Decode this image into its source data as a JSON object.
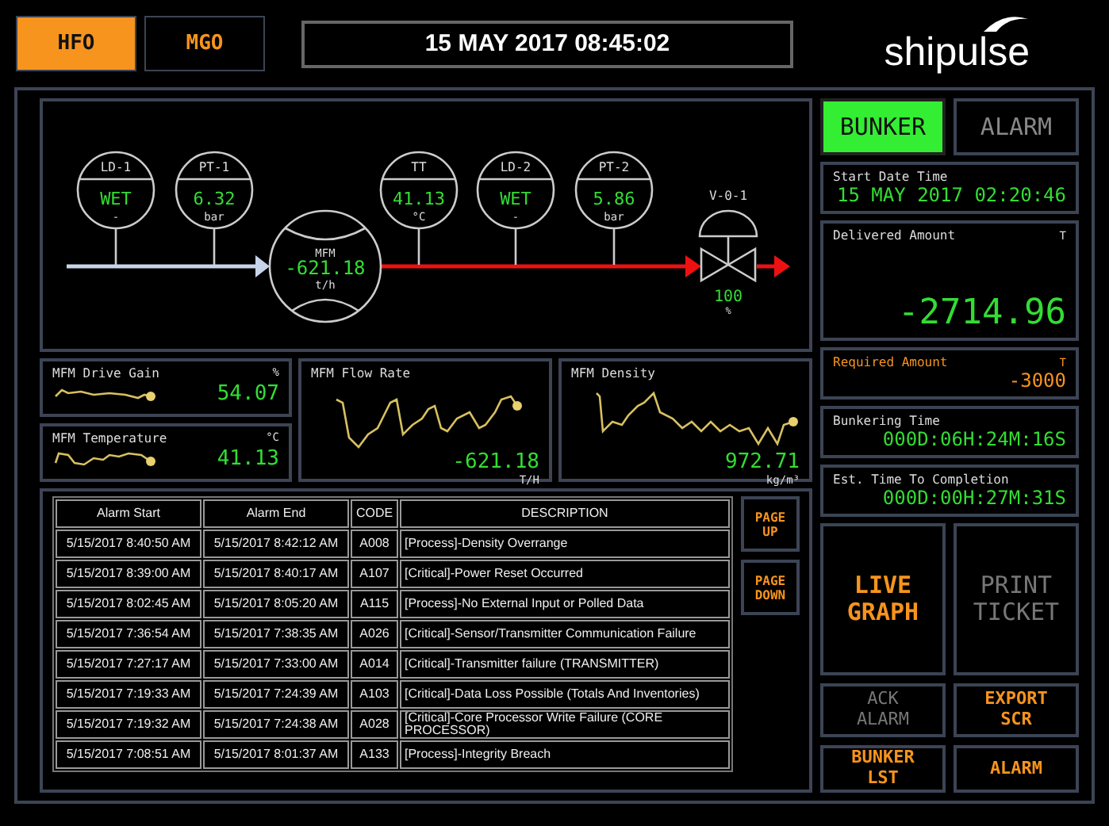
{
  "fuel_tabs": [
    {
      "label": "HFO",
      "selected": true
    },
    {
      "label": "MGO",
      "selected": false
    }
  ],
  "datetime": "15 MAY 2017 08:45:02",
  "logo": "shipulse",
  "diagram": {
    "instruments": [
      {
        "kind": "transmitter",
        "tag": "LD-1",
        "value": "WET",
        "unit": "-"
      },
      {
        "kind": "transmitter",
        "tag": "PT-1",
        "value": "6.32",
        "unit": "bar"
      },
      {
        "kind": "flowmeter",
        "tag": "MFM",
        "value": "-621.18",
        "unit": "t/h"
      },
      {
        "kind": "transmitter",
        "tag": "TT",
        "value": "41.13",
        "unit": "°C"
      },
      {
        "kind": "transmitter",
        "tag": "LD-2",
        "value": "WET",
        "unit": "-"
      },
      {
        "kind": "transmitter",
        "tag": "PT-2",
        "value": "5.86",
        "unit": "bar"
      },
      {
        "kind": "valve",
        "tag": "V-0-1",
        "value": "100",
        "unit": "%"
      }
    ]
  },
  "trends": [
    {
      "kind": "compact",
      "label": "MFM Drive Gain",
      "unit": "%",
      "value": "54.07"
    },
    {
      "kind": "compact",
      "label": "MFM Temperature",
      "unit": "°C",
      "value": "41.13"
    },
    {
      "kind": "wide",
      "label": "MFM Flow Rate",
      "unit": "T/H",
      "value": "-621.18"
    },
    {
      "kind": "wide",
      "label": "MFM Density",
      "unit": "kg/m³",
      "value": "972.71"
    }
  ],
  "alarm_table": {
    "columns": [
      "Alarm Start",
      "Alarm End",
      "CODE",
      "DESCRIPTION"
    ],
    "rows": [
      [
        "5/15/2017 8:40:50 AM",
        "5/15/2017 8:42:12 AM",
        "A008",
        "[Process]-Density Overrange"
      ],
      [
        "5/15/2017 8:39:00 AM",
        "5/15/2017 8:40:17 AM",
        "A107",
        "[Critical]-Power Reset Occurred"
      ],
      [
        "5/15/2017 8:02:45 AM",
        "5/15/2017 8:05:20 AM",
        "A115",
        "[Process]-No External Input or Polled Data"
      ],
      [
        "5/15/2017 7:36:54 AM",
        "5/15/2017 7:38:35 AM",
        "A026",
        "[Critical]-Sensor/Transmitter Communication Failure"
      ],
      [
        "5/15/2017 7:27:17 AM",
        "5/15/2017 7:33:00 AM",
        "A014",
        "[Critical]-Transmitter failure (TRANSMITTER)"
      ],
      [
        "5/15/2017 7:19:33 AM",
        "5/15/2017 7:24:39 AM",
        "A103",
        "[Critical]-Data Loss Possible (Totals And Inventories)"
      ],
      [
        "5/15/2017 7:19:32 AM",
        "5/15/2017 7:24:38 AM",
        "A028",
        "[Critical]-Core Processor Write Failure (CORE PROCESSOR)"
      ],
      [
        "5/15/2017 7:08:51 AM",
        "5/15/2017 8:01:37 AM",
        "A133",
        "[Process]-Integrity Breach"
      ]
    ],
    "page_buttons": [
      "PAGE UP",
      "PAGE DOWN"
    ]
  },
  "mode_tabs": [
    {
      "label": "BUNKER",
      "selected": true
    },
    {
      "label": "ALARM",
      "selected": false
    }
  ],
  "info_cards": [
    {
      "kind": "normal",
      "label": "Start Date Time",
      "value": "15 MAY 2017 02:20:46"
    },
    {
      "kind": "large",
      "label": "Delivered Amount",
      "unit": "T",
      "value": "-2714.96"
    },
    {
      "kind": "required",
      "label": "Required Amount",
      "unit": "T",
      "value": "-3000"
    },
    {
      "kind": "normal",
      "label": "Bunkering Time",
      "value": "000D:06H:24M:16S"
    },
    {
      "kind": "normal",
      "label": "Est. Time To Completion",
      "value": "000D:00H:27M:31S"
    }
  ],
  "actions": [
    {
      "kind": "large",
      "label": "LIVE GRAPH",
      "disabled": false
    },
    {
      "kind": "large",
      "label": "PRINT TICKET",
      "disabled": true
    },
    {
      "kind": "small",
      "label": "ACK ALARM",
      "disabled": true
    },
    {
      "kind": "small",
      "label": "EXPORT SCR",
      "disabled": false
    },
    {
      "kind": "small",
      "label": "BUNKER LST",
      "disabled": false
    },
    {
      "kind": "small",
      "label": "ALARM",
      "disabled": false
    }
  ]
}
